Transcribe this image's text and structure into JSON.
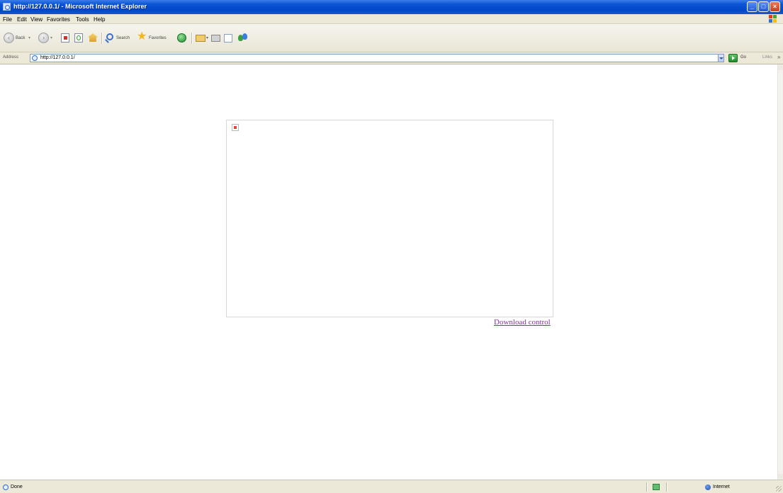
{
  "window": {
    "title": "http://127.0.0.1/ - Microsoft Internet Explorer",
    "minimize_label": "_",
    "maximize_label": "□",
    "close_label": "×"
  },
  "menu": [
    "File",
    "Edit",
    "View",
    "Favorites",
    "Tools",
    "Help"
  ],
  "toolbar": {
    "back_label": "Back",
    "search_label": "Search",
    "favorites_label": "Favorites"
  },
  "address_bar": {
    "label": "Address",
    "url": "http://127.0.0.1/",
    "go_label": "Go",
    "links_label": "Links"
  },
  "content": {
    "link_text": "Download control"
  },
  "status_bar": {
    "status": "Done",
    "zone": "Internet"
  },
  "colors": {
    "titlebar": "#0048c8",
    "chrome": "#ece9d8",
    "visited_link": "#8a2ea8"
  },
  "icons": [
    "ie-page-icon",
    "back-icon",
    "forward-icon",
    "stop-icon",
    "refresh-icon",
    "home-icon",
    "search-icon",
    "favorites-star-icon",
    "media-icon",
    "mail-icon",
    "print-icon",
    "edit-icon",
    "messenger-icon",
    "windows-logo-icon",
    "go-arrow-icon",
    "broken-plugin-icon",
    "globe-icon"
  ]
}
